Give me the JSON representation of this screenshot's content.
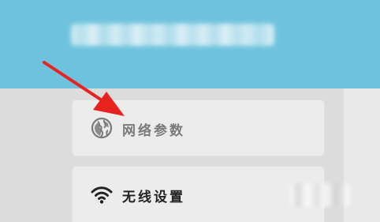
{
  "header": {
    "background_color": "#6fc2dd",
    "title_obscured": true
  },
  "menu": {
    "items": [
      {
        "label": "网络参数",
        "icon": "globe-icon",
        "label_color": "#7a7a7a"
      },
      {
        "label": "无线设置",
        "icon": "wifi-icon",
        "label_color": "#222222"
      }
    ]
  },
  "annotation": {
    "arrow_color": "#e8231f",
    "points_to": "网络参数"
  }
}
